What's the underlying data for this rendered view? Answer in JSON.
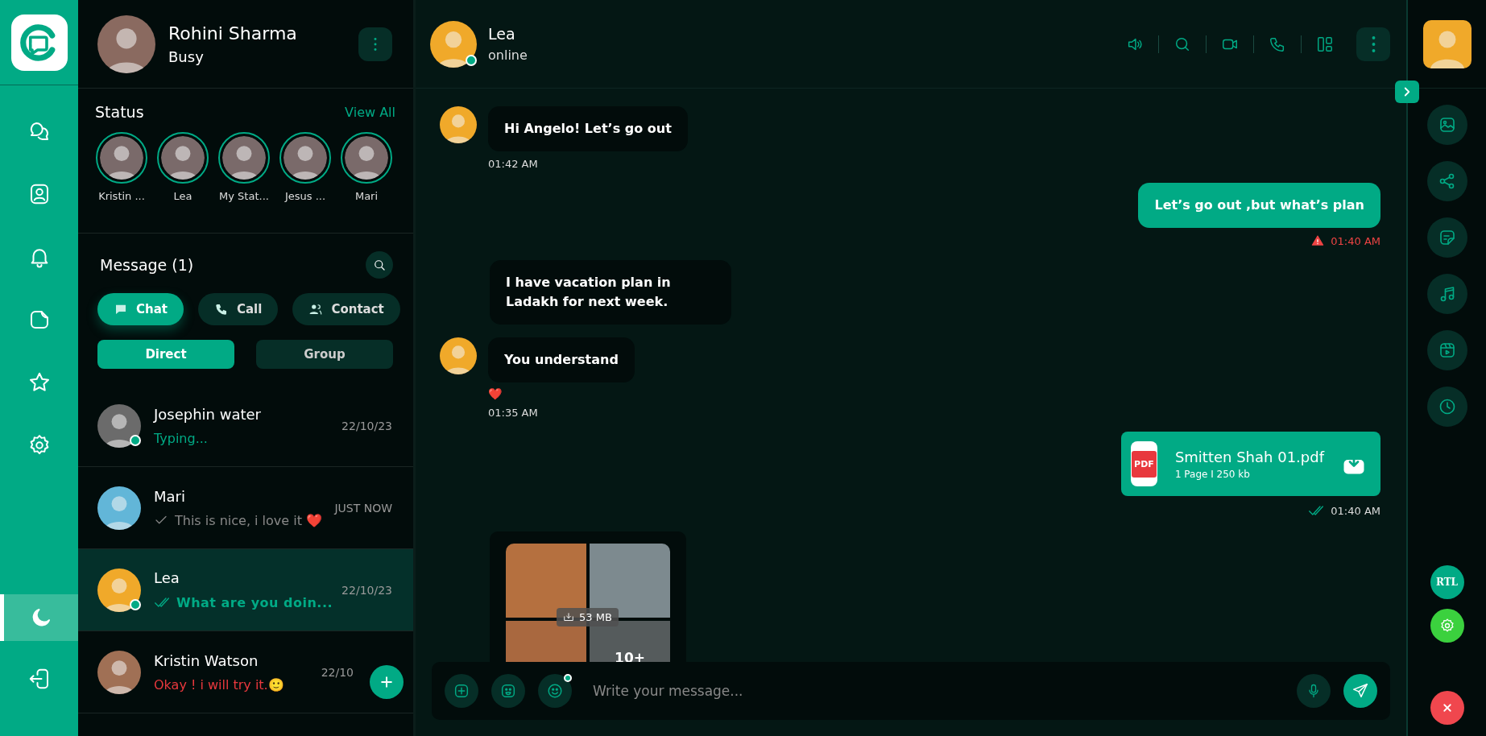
{
  "rail": {
    "items": [
      {
        "kind": "chats",
        "selected": false
      },
      {
        "kind": "contacts",
        "selected": false
      },
      {
        "kind": "notifications",
        "selected": false
      },
      {
        "kind": "documents",
        "selected": false
      },
      {
        "kind": "favourites",
        "selected": false
      },
      {
        "kind": "settings",
        "selected": false
      }
    ],
    "bottom": [
      {
        "kind": "dark-mode",
        "selected": true
      },
      {
        "kind": "logout",
        "selected": false
      }
    ]
  },
  "profile": {
    "name": "Rohini Sharma",
    "status": "Busy"
  },
  "status": {
    "title": "Status",
    "link": "View All",
    "stories": [
      {
        "name": "Kristin ..."
      },
      {
        "name": "Lea"
      },
      {
        "name": "My Stat..."
      },
      {
        "name": "Jesus ..."
      },
      {
        "name": "Mari"
      }
    ]
  },
  "messages": {
    "title": "Message (1)",
    "tabs": [
      {
        "label": "Chat",
        "kind": "chat",
        "selected": true
      },
      {
        "label": "Call",
        "kind": "call",
        "selected": false
      },
      {
        "label": "Contact",
        "kind": "contact",
        "selected": false
      }
    ],
    "filters": [
      {
        "label": "Direct",
        "selected": true
      },
      {
        "label": "Group",
        "selected": false
      }
    ],
    "chats": [
      {
        "name": "Josephin water",
        "preview": "Typing...",
        "kind": "typing",
        "time": "22/10/23",
        "online": true,
        "selected": false
      },
      {
        "name": "Mari",
        "preview": "This is nice, i love it ❤️",
        "kind": "sent",
        "time": "JUST NOW",
        "online": false,
        "selected": false
      },
      {
        "name": "Lea",
        "preview": "What are you doin...",
        "kind": "read",
        "time": "22/10/23",
        "online": true,
        "selected": true
      },
      {
        "name": "Kristin Watson",
        "preview": "Okay ! i will try it.🙂",
        "kind": "alert",
        "time": "22/10",
        "online": false,
        "selected": false
      }
    ]
  },
  "chat": {
    "contact": {
      "name": "Lea",
      "status": "online",
      "online": true
    },
    "messages": [
      {
        "kind": "text",
        "outgoing": false,
        "text": "Hi Angelo! Let’s go out",
        "time": "01:42 AM",
        "avatar": true
      },
      {
        "kind": "text",
        "outgoing": true,
        "text": "Let’s go out ,but what’s plan",
        "time": "01:40 AM",
        "failed": true
      },
      {
        "kind": "text",
        "outgoing": false,
        "text": "I have vacation plan in Ladakh for next week.",
        "avatar": false
      },
      {
        "kind": "text",
        "outgoing": false,
        "text": "You understand",
        "reaction": "❤️",
        "time": "01:35 AM",
        "avatar": true
      },
      {
        "kind": "file",
        "outgoing": true,
        "file_type": "PDF",
        "name": "Smitten Shah 01.pdf",
        "meta": "1 Page I 250 kb",
        "time": "01:40 AM",
        "read": true
      },
      {
        "kind": "gallery",
        "outgoing": false,
        "size": "53 MB",
        "more": "10+",
        "avatar": false
      }
    ],
    "composer": {
      "placeholder": "Write your message..."
    }
  },
  "side_panel": {
    "items": [
      {
        "kind": "media"
      },
      {
        "kind": "share"
      },
      {
        "kind": "notes"
      },
      {
        "kind": "music"
      },
      {
        "kind": "video"
      },
      {
        "kind": "history"
      }
    ],
    "rtl": "RTL"
  }
}
